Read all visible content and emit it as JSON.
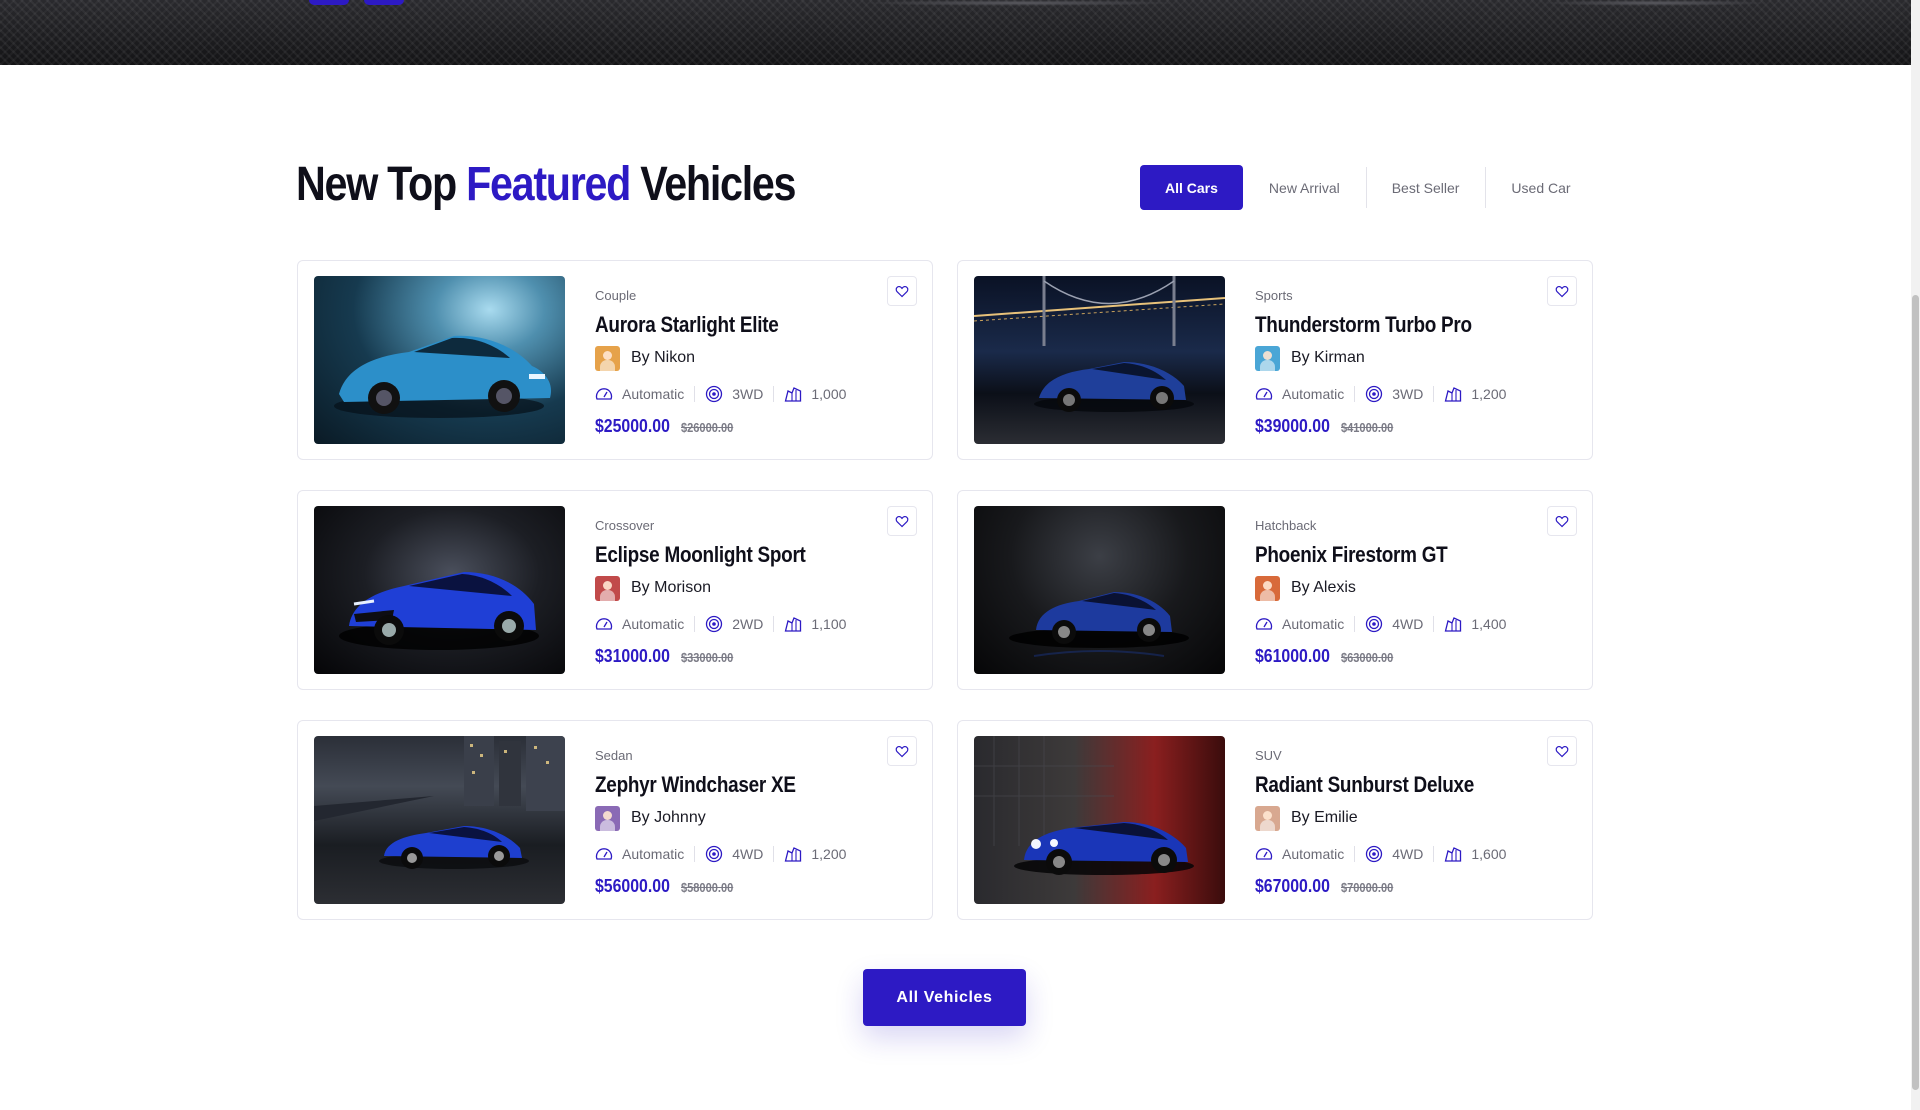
{
  "section": {
    "title_prefix": "New Top",
    "title_accent": "Featured",
    "title_suffix": "Vehicles"
  },
  "filters": [
    {
      "label": "All Cars",
      "active": true
    },
    {
      "label": "New Arrival",
      "active": false
    },
    {
      "label": "Best Seller",
      "active": false
    },
    {
      "label": "Used Car",
      "active": false
    }
  ],
  "vehicles": [
    {
      "category": "Couple",
      "name": "Aurora Starlight Elite",
      "seller": "By Nikon",
      "transmission": "Automatic",
      "drive": "3WD",
      "mileage": "1,000",
      "price": "$25000.00",
      "old_price": "$26000.00"
    },
    {
      "category": "Sports",
      "name": "Thunderstorm Turbo Pro",
      "seller": "By Kirman",
      "transmission": "Automatic",
      "drive": "3WD",
      "mileage": "1,200",
      "price": "$39000.00",
      "old_price": "$41000.00"
    },
    {
      "category": "Crossover",
      "name": "Eclipse Moonlight Sport",
      "seller": "By Morison",
      "transmission": "Automatic",
      "drive": "2WD",
      "mileage": "1,100",
      "price": "$31000.00",
      "old_price": "$33000.00"
    },
    {
      "category": "Hatchback",
      "name": "Phoenix Firestorm GT",
      "seller": "By Alexis",
      "transmission": "Automatic",
      "drive": "4WD",
      "mileage": "1,400",
      "price": "$61000.00",
      "old_price": "$63000.00"
    },
    {
      "category": "Sedan",
      "name": "Zephyr Windchaser XE",
      "seller": "By Johnny",
      "transmission": "Automatic",
      "drive": "4WD",
      "mileage": "1,200",
      "price": "$56000.00",
      "old_price": "$58000.00"
    },
    {
      "category": "SUV",
      "name": "Radiant Sunburst Deluxe",
      "seller": "By Emilie",
      "transmission": "Automatic",
      "drive": "4WD",
      "mileage": "1,600",
      "price": "$67000.00",
      "old_price": "$70000.00"
    }
  ],
  "cta": {
    "label": "All Vehicles"
  },
  "icons": {
    "wishlist": "heart-icon",
    "transmission": "speedometer-icon",
    "drive": "target-icon",
    "mileage": "road-map-icon"
  },
  "colors": {
    "accent": "#2d1ac4",
    "text_dark": "#0f0f1a",
    "muted": "#6b6b76",
    "border": "#e6e6ee"
  }
}
